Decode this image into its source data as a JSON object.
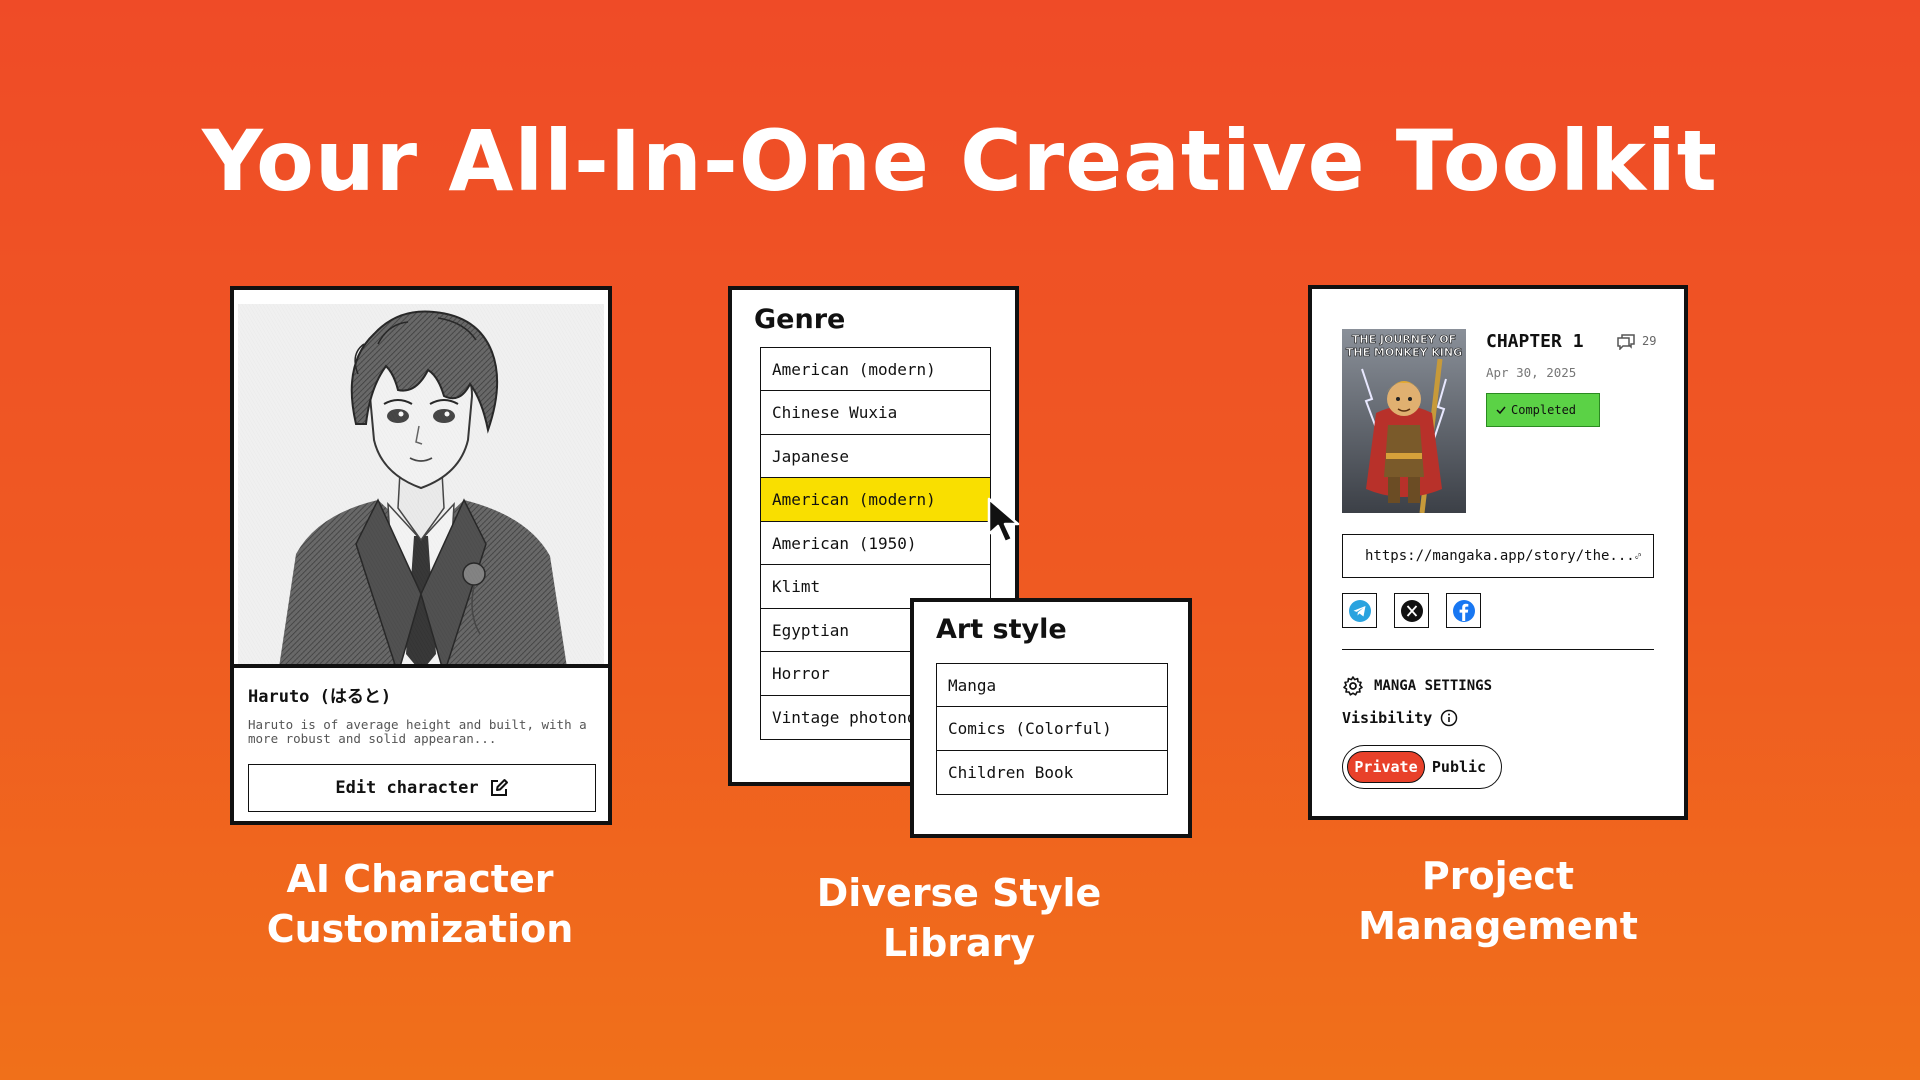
{
  "page": {
    "title": "Your All-In-One Creative Toolkit"
  },
  "character_card": {
    "name": "Haruto (はると)",
    "description": "Haruto is of average height and built, with a more robust and solid appearan...",
    "edit_button_label": "Edit character",
    "caption_line1": "AI Character",
    "caption_line2": "Customization"
  },
  "genre_panel": {
    "title": "Genre",
    "items": [
      "American (modern)",
      "Chinese Wuxia",
      "Japanese",
      "American (modern)",
      "American (1950)",
      "Klimt",
      "Egyptian",
      "Horror",
      "Vintage photonovel"
    ],
    "selected_index": 3,
    "selected_color": "#f9df00"
  },
  "art_style_panel": {
    "title": "Art style",
    "items": [
      "Manga",
      "Comics (Colorful)",
      "Children Book"
    ]
  },
  "style_caption": {
    "line1": "Diverse Style",
    "line2": "Library"
  },
  "project_panel": {
    "cover_title_line1": "THE JOURNEY OF",
    "cover_title_line2": "THE MONKEY KING",
    "chapter_title": "CHAPTER 1",
    "comment_count": "29",
    "date": "Apr 30, 2025",
    "status": "Completed",
    "status_color": "#5bd246",
    "url": "https://mangaka.app/story/the...",
    "share_icons": [
      "telegram-icon",
      "x-icon",
      "facebook-icon"
    ],
    "settings_label": "MANGA SETTINGS",
    "visibility_label": "Visibility",
    "visibility_options": [
      "Private",
      "Public"
    ],
    "visibility_selected": "Private",
    "accent_color": "#e8412a"
  },
  "project_caption": {
    "line1": "Project",
    "line2": "Management"
  },
  "colors": {
    "background_top": "#ef4b27",
    "background_bottom": "#f0701a"
  }
}
